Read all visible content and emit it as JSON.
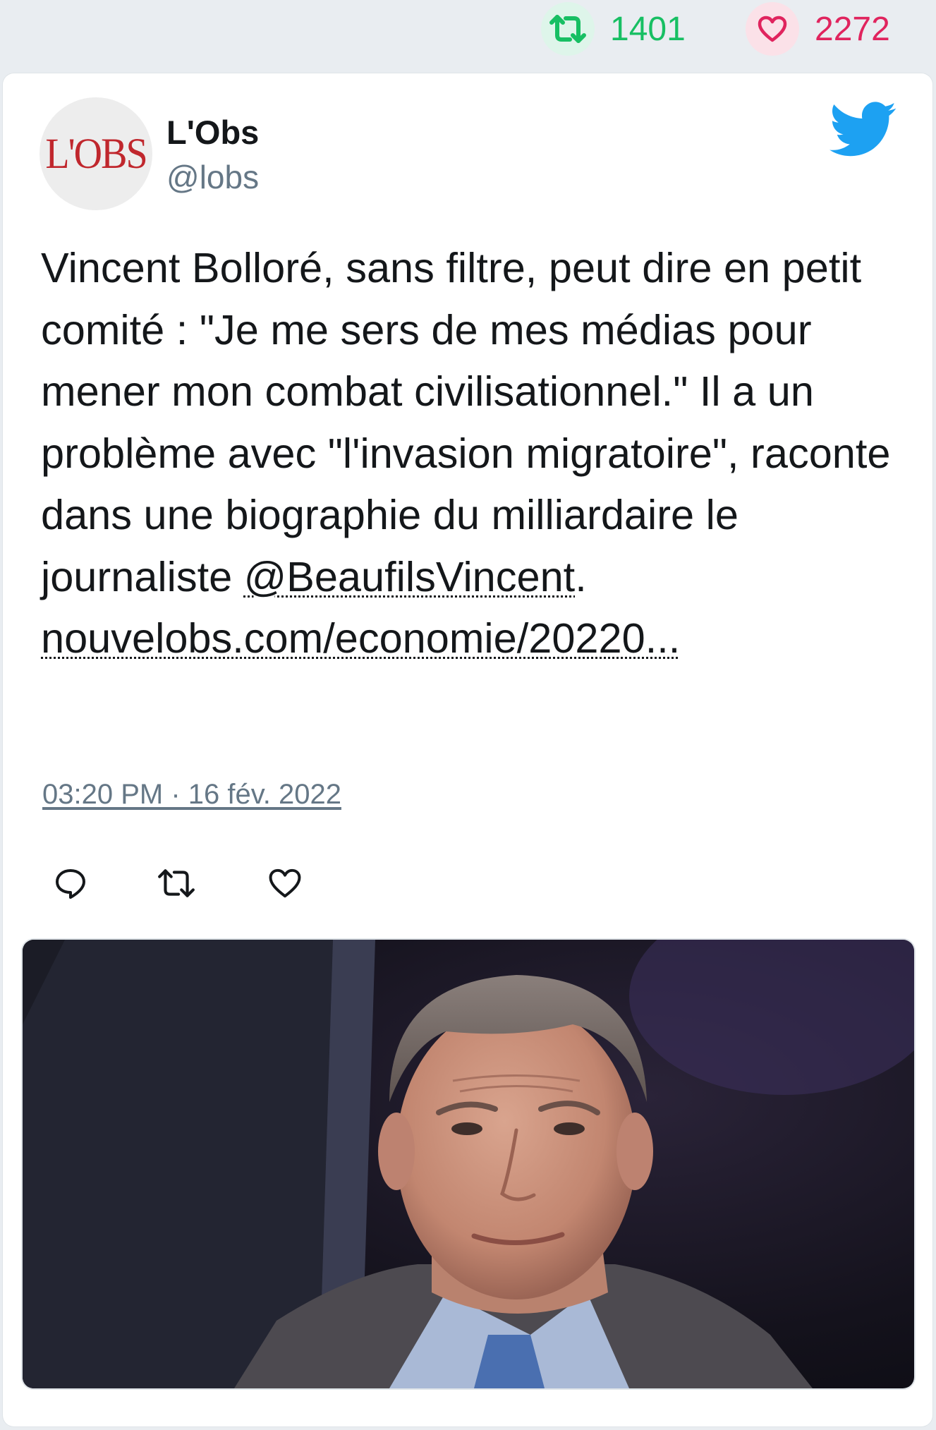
{
  "stats": {
    "retweets": "1401",
    "likes": "2272",
    "retweet_color": "#17bf63",
    "like_color": "#e0245e"
  },
  "tweet": {
    "author_name": "L'Obs",
    "author_handle": "@lobs",
    "avatar_text": "L'OBS",
    "text_part1": "Vincent Bolloré, sans filtre, peut dire en petit comité : \"Je me sers de mes médias pour mener mon combat civilisationnel.\" Il a un problème avec \"l'invasion migratoire\", raconte dans une biographie du milliardaire le journaliste ",
    "mention": "@BeaufilsVincent",
    "text_part2": ".",
    "link": "nouvelobs.com/economie/20220...",
    "timestamp": "03:20 PM · 16 fév. 2022"
  },
  "icons": {
    "retweet": "retweet-icon",
    "like": "heart-icon",
    "reply": "reply-icon",
    "brand": "twitter-bird-icon"
  },
  "colors": {
    "brand_blue": "#1da1f2",
    "text": "#14171a",
    "muted": "#657786"
  }
}
